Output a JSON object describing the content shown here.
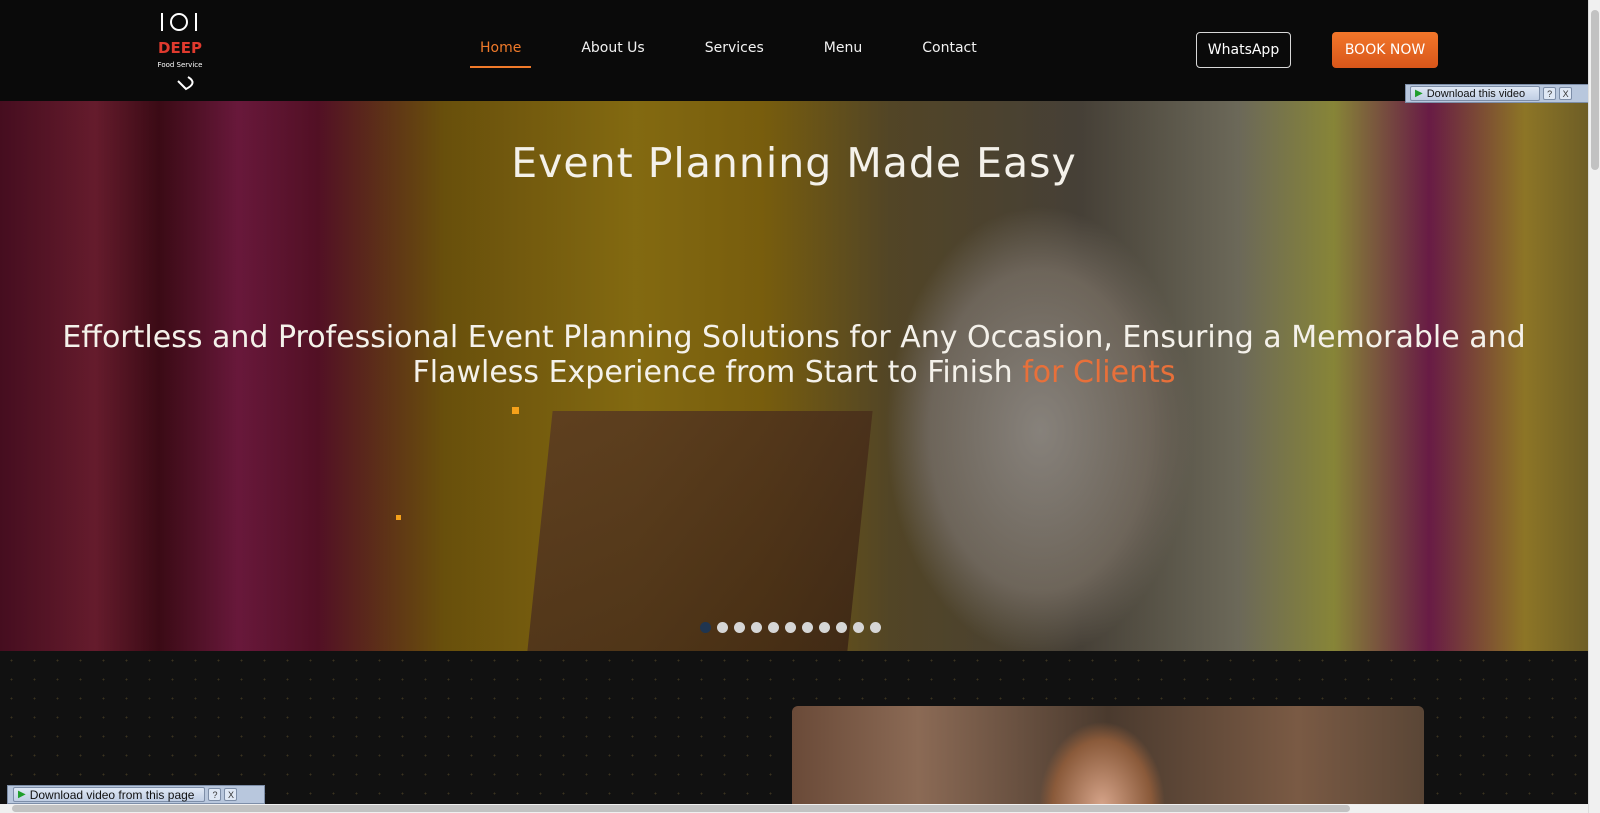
{
  "header": {
    "nav": [
      {
        "label": "Home",
        "active": true
      },
      {
        "label": "About Us",
        "active": false
      },
      {
        "label": "Services",
        "active": false
      },
      {
        "label": "Menu",
        "active": false
      },
      {
        "label": "Contact",
        "active": false
      }
    ],
    "whatsapp_label": "WhatsApp",
    "book_label": "BOOK NOW",
    "accent_color": "#f07a2a"
  },
  "logo": {
    "text_main": "DEEP",
    "text_sub": "Food Service"
  },
  "hero": {
    "title": "Event Planning Made Easy",
    "subtitle_main": "Effortless and Professional Event Planning Solutions for Any Occasion, Ensuring a Memorable and Flawless Experience from Start to Finish",
    "subtitle_accent": "for Clients",
    "slide_count": 11,
    "active_slide": 1
  },
  "overlays": {
    "download_top": "Download this video",
    "download_bottom": "Download video from this page",
    "help": "?",
    "close": "X"
  }
}
